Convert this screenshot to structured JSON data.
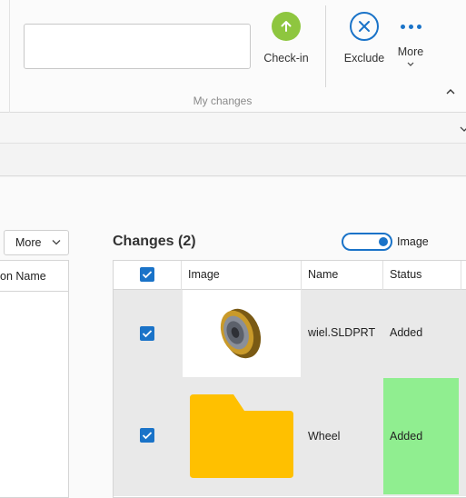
{
  "ribbon": {
    "comment_placeholder": "",
    "checkin_label": "Check-in",
    "exclude_label": "Exclude",
    "more_label": "More",
    "group_label": "My changes"
  },
  "left_panel": {
    "more_dropdown": "More",
    "column_header": "on Name"
  },
  "changes": {
    "title": "Changes (2)",
    "toggle_label": "Image",
    "toggle_on": true,
    "columns": [
      "Image",
      "Name",
      "Status"
    ],
    "rows": [
      {
        "checked": true,
        "thumbnail": "gear-part-thumbnail",
        "name": "wiel.SLDPRT",
        "status": "Added"
      },
      {
        "checked": true,
        "thumbnail": "folder-thumbnail",
        "name": "Wheel",
        "status": "Added",
        "status_color": "#90ee90"
      }
    ]
  },
  "colors": {
    "accent": "#1a73c8",
    "checkin_green": "#8ec63f",
    "folder_yellow": "#ffc000",
    "status_added_highlight": "#90ee90"
  }
}
